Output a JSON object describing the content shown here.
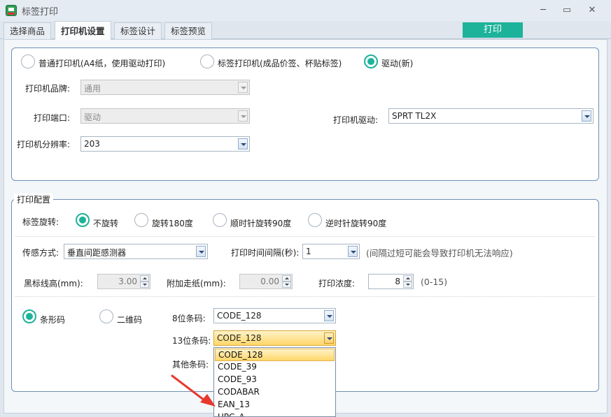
{
  "window": {
    "title": "标签打印",
    "minimize": "─",
    "maximize": "▭",
    "close": "✕"
  },
  "tabs": [
    {
      "label": "选择商品",
      "active": false
    },
    {
      "label": "打印机设置",
      "active": true
    },
    {
      "label": "标签设计",
      "active": false
    },
    {
      "label": "标签预览",
      "active": false
    }
  ],
  "print_button": "打印",
  "printer_type": {
    "options": [
      {
        "label": "普通打印机(A4纸，使用驱动打印)",
        "checked": false
      },
      {
        "label": "标签打印机(成品价签、杯贴标签)",
        "checked": false
      },
      {
        "label": "驱动(新)",
        "checked": true
      }
    ],
    "brand_label": "打印机品牌:",
    "brand_value": "通用",
    "port_label": "打印端口:",
    "port_value": "驱动",
    "resolution_label": "打印机分辨率:",
    "resolution_value": "203",
    "driver_label": "打印机驱动:",
    "driver_value": "SPRT TL2X"
  },
  "print_config": {
    "legend": "打印配置",
    "rotation_label": "标签旋转:",
    "rotation_options": [
      {
        "label": "不旋转",
        "checked": true
      },
      {
        "label": "旋转180度",
        "checked": false
      },
      {
        "label": "顺时针旋转90度",
        "checked": false
      },
      {
        "label": "逆时针旋转90度",
        "checked": false
      }
    ],
    "sensor_label": "传感方式:",
    "sensor_value": "垂直间距感测器",
    "interval_label": "打印时间间隔(秒):",
    "interval_value": "1",
    "interval_hint": "(间隔过短可能会导致打印机无法响应)",
    "blackmark_label": "黑标线高(mm):",
    "blackmark_value": "3.00",
    "feed_label": "附加走纸(mm):",
    "feed_value": "0.00",
    "density_label": "打印浓度:",
    "density_value": "8",
    "density_hint": "(0-15)",
    "code_type_options": [
      {
        "label": "条形码",
        "checked": true
      },
      {
        "label": "二维码",
        "checked": false
      }
    ],
    "code8_label": "8位条码:",
    "code8_value": "CODE_128",
    "code13_label": "13位条码:",
    "code13_value": "CODE_128",
    "other_label": "其他条码:",
    "dropdown_items": [
      "CODE_128",
      "CODE_39",
      "CODE_93",
      "CODABAR",
      "EAN_13",
      "UPC_A"
    ],
    "dropdown_selected": "CODE_128"
  },
  "colors": {
    "accent": "#1db39a",
    "arrow": "#e8382e"
  }
}
